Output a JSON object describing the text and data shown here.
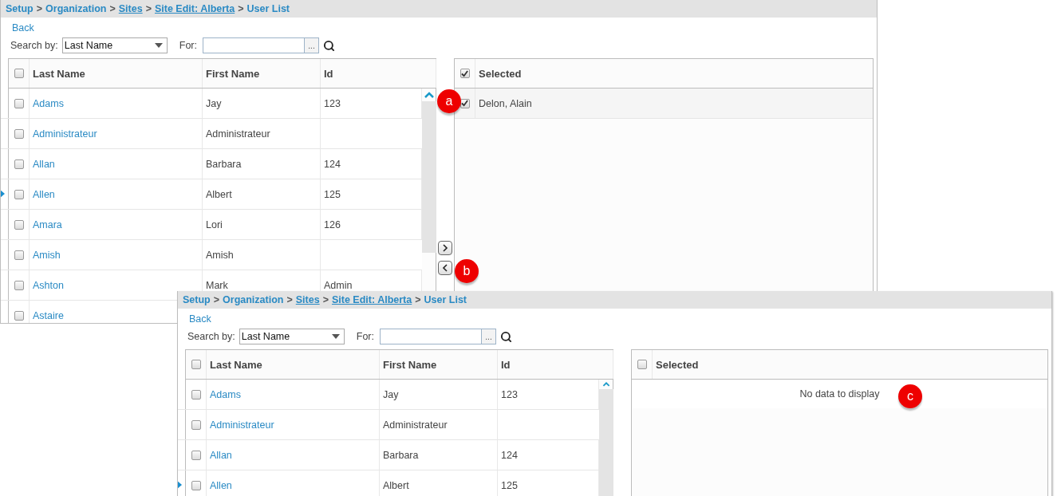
{
  "panels": [
    {
      "breadcrumb": [
        {
          "text": "Setup",
          "kind": "plain"
        },
        {
          "text": ">",
          "kind": "separator"
        },
        {
          "text": "Organization",
          "kind": "plain"
        },
        {
          "text": ">",
          "kind": "separator"
        },
        {
          "text": "Sites",
          "kind": "link"
        },
        {
          "text": ">",
          "kind": "separator"
        },
        {
          "text": "Site Edit: Alberta",
          "kind": "link"
        },
        {
          "text": ">",
          "kind": "separator"
        },
        {
          "text": "User List",
          "kind": "plain"
        }
      ],
      "back": "Back",
      "search_by_label": "Search by:",
      "search_by_value": "Last Name",
      "for_label": "For:",
      "for_button": "...",
      "header_checked": false,
      "columns": [
        "Last Name",
        "First Name",
        "Id"
      ],
      "rows": [
        {
          "checked": false,
          "current": false,
          "last": "Adams",
          "first": "Jay",
          "id": "123"
        },
        {
          "checked": false,
          "current": false,
          "last": "Administrateur",
          "first": "Administrateur"
        },
        {
          "checked": false,
          "current": false,
          "last": "Allan",
          "first": "Barbara",
          "id": "124"
        },
        {
          "checked": false,
          "current": true,
          "last": "Allen",
          "first": "Albert",
          "id": "125"
        },
        {
          "checked": false,
          "current": false,
          "last": "Amara",
          "first": "Lori",
          "id": "126"
        },
        {
          "checked": false,
          "current": false,
          "last": "Amish",
          "first": "Amish"
        },
        {
          "checked": false,
          "current": false,
          "last": "Ashton",
          "first": "Mark",
          "id": "Admin"
        },
        {
          "checked": false,
          "current": false,
          "last": "Astaire"
        }
      ],
      "move_buttons": [
        {
          "kind": "right"
        },
        {
          "kind": "left"
        }
      ],
      "selected_header": {
        "label": "Selected",
        "checked": true
      },
      "selected_rows": [
        {
          "checked": true,
          "text": "Delon, Alain"
        }
      ],
      "callouts": [
        {
          "label": "a"
        },
        {
          "label": "b"
        }
      ]
    },
    {
      "breadcrumb": [
        {
          "text": "Setup",
          "kind": "plain"
        },
        {
          "text": ">",
          "kind": "separator"
        },
        {
          "text": "Organization",
          "kind": "plain"
        },
        {
          "text": ">",
          "kind": "separator"
        },
        {
          "text": "Sites",
          "kind": "link"
        },
        {
          "text": ">",
          "kind": "separator"
        },
        {
          "text": "Site Edit: Alberta",
          "kind": "link"
        },
        {
          "text": ">",
          "kind": "separator"
        },
        {
          "text": "User List",
          "kind": "plain"
        }
      ],
      "back": "Back",
      "search_by_label": "Search by:",
      "search_by_value": "Last Name",
      "for_label": "For:",
      "for_button": "...",
      "header_checked": false,
      "columns": [
        "Last Name",
        "First Name",
        "Id"
      ],
      "rows": [
        {
          "checked": false,
          "current": false,
          "last": "Adams",
          "first": "Jay",
          "id": "123"
        },
        {
          "checked": false,
          "current": false,
          "last": "Administrateur",
          "first": "Administrateur"
        },
        {
          "checked": false,
          "current": false,
          "last": "Allan",
          "first": "Barbara",
          "id": "124"
        },
        {
          "checked": false,
          "current": true,
          "last": "Allen",
          "first": "Albert",
          "id": "125"
        }
      ],
      "selected_header": {
        "label": "Selected",
        "checked": false
      },
      "empty_text": "No data to display",
      "callouts": [
        {
          "label": "c"
        }
      ]
    }
  ]
}
